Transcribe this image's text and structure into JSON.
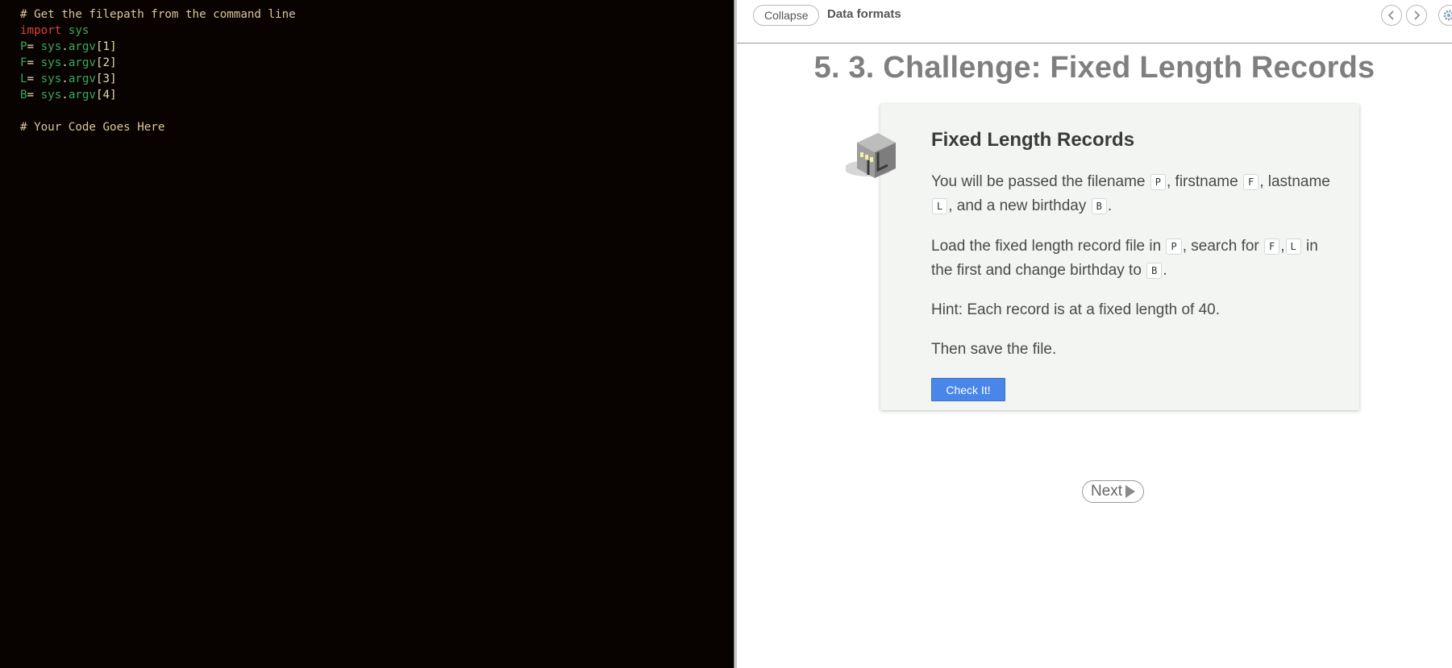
{
  "editor": {
    "lines": [
      {
        "comment": "# Get the filepath from the command line"
      },
      {
        "kw": "import",
        "mod": "sys"
      },
      {
        "var": "P",
        "eq": "= ",
        "obj": "sys",
        "dot": ".",
        "attr": "argv",
        "idx": "[1]"
      },
      {
        "var": "F",
        "eq": "= ",
        "obj": "sys",
        "dot": ".",
        "attr": "argv",
        "idx": "[2]"
      },
      {
        "var": "L",
        "eq": "= ",
        "obj": "sys",
        "dot": ".",
        "attr": "argv",
        "idx": "[3]"
      },
      {
        "var": "B",
        "eq": "= ",
        "obj": "sys",
        "dot": ".",
        "attr": "argv",
        "idx": "[4]"
      },
      {
        "blank": ""
      },
      {
        "comment": "# Your Code Goes Here"
      }
    ]
  },
  "header": {
    "collapse_label": "Collapse",
    "breadcrumb": "Data formats",
    "prev_icon": "chevron-left-icon",
    "next_icon": "chevron-right-icon",
    "settings_icon": "gear-icon"
  },
  "page": {
    "title": "5. 3. Challenge: Fixed Length Records"
  },
  "card": {
    "title": "Fixed Length Records",
    "icon": "challenge-icon",
    "p1": {
      "t1": "You will be passed the filename ",
      "c1": "P",
      "t2": ", firstname ",
      "c2": "F",
      "t3": ", lastname ",
      "c3": "L",
      "t4": ", and a new birthday ",
      "c4": "B",
      "t5": "."
    },
    "p2": {
      "t1": "Load the fixed length record file in ",
      "c1": "P",
      "t2": ", search for ",
      "c2": "F",
      "t3": ",",
      "c3": "L",
      "t4": " in the first and change birthday to ",
      "c4": "B",
      "t5": "."
    },
    "p3": "Hint: Each record is at a fixed length of 40.",
    "p4": "Then save the file.",
    "check_label": "Check It!"
  },
  "footer": {
    "next_label": "Next"
  },
  "colors": {
    "editor_bg": "#080300",
    "keyword": "#d7433a",
    "identifier": "#38a85b",
    "accent_button": "#4a86e8"
  }
}
